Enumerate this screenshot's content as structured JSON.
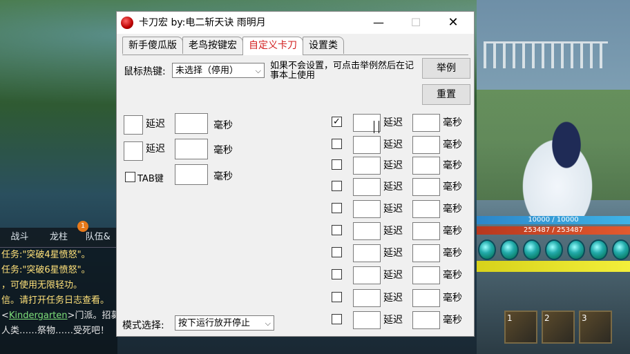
{
  "window": {
    "title": "卡刀宏 by:电二斩天诀 雨明月",
    "minimize": "—",
    "maximize": "☐",
    "close": "✕"
  },
  "tabs": [
    {
      "label": "新手傻瓜版",
      "active": false
    },
    {
      "label": "老鸟按键宏",
      "active": false
    },
    {
      "label": "自定义卡刀",
      "active": true
    },
    {
      "label": "设置类",
      "active": false
    }
  ],
  "hotkey": {
    "label": "鼠标热键:",
    "value": "未选择（停用）",
    "note": "如果不会设置，可点击举例然后在记事本上使用"
  },
  "buttons": {
    "example": "举例",
    "reset": "重置"
  },
  "left_rows": [
    {
      "delay_label": "延迟",
      "ms_label": "毫秒"
    },
    {
      "delay_label": "延迟",
      "ms_label": "毫秒"
    }
  ],
  "tab_row": {
    "label": "TAB键",
    "ms_label": "毫秒",
    "checked": false
  },
  "right_rows": [
    {
      "checked": true,
      "delay_label": "延迟",
      "ms_label": "毫秒"
    },
    {
      "checked": false,
      "delay_label": "延迟",
      "ms_label": "毫秒"
    },
    {
      "checked": false,
      "delay_label": "延迟",
      "ms_label": "毫秒"
    },
    {
      "checked": false,
      "delay_label": "延迟",
      "ms_label": "毫秒"
    },
    {
      "checked": false,
      "delay_label": "延迟",
      "ms_label": "毫秒"
    },
    {
      "checked": false,
      "delay_label": "延迟",
      "ms_label": "毫秒"
    },
    {
      "checked": false,
      "delay_label": "延迟",
      "ms_label": "毫秒"
    },
    {
      "checked": false,
      "delay_label": "延迟",
      "ms_label": "毫秒"
    },
    {
      "checked": false,
      "delay_label": "延迟",
      "ms_label": "毫秒"
    },
    {
      "checked": false,
      "delay_label": "延迟",
      "ms_label": "毫秒"
    }
  ],
  "mode": {
    "label": "模式选择:",
    "value": "按下运行放开停止"
  },
  "game": {
    "hp_text": "10000 / 10000",
    "hp2_text": "253487 / 253487",
    "chat_tabs": [
      "战斗",
      "龙柱",
      "队伍&"
    ],
    "chat_badge": "1",
    "chat_lines": [
      {
        "text": "任务:\"突破4星愤怒\"。",
        "color": "yellow"
      },
      {
        "text": "任务:\"突破6星愤怒\"。",
        "color": "yellow"
      },
      {
        "text": "，可使用无限轻功。",
        "color": "yellow"
      },
      {
        "text": "信。请打开任务日志查看。",
        "color": "yellow"
      },
      {
        "prefix": "<",
        "link": "Kindergarten",
        "text": ">门派。招募",
        "color": "green"
      },
      {
        "text": "人类……祭物……受死吧！",
        "color": "white"
      }
    ],
    "skills": [
      "1",
      "2",
      "3"
    ]
  }
}
